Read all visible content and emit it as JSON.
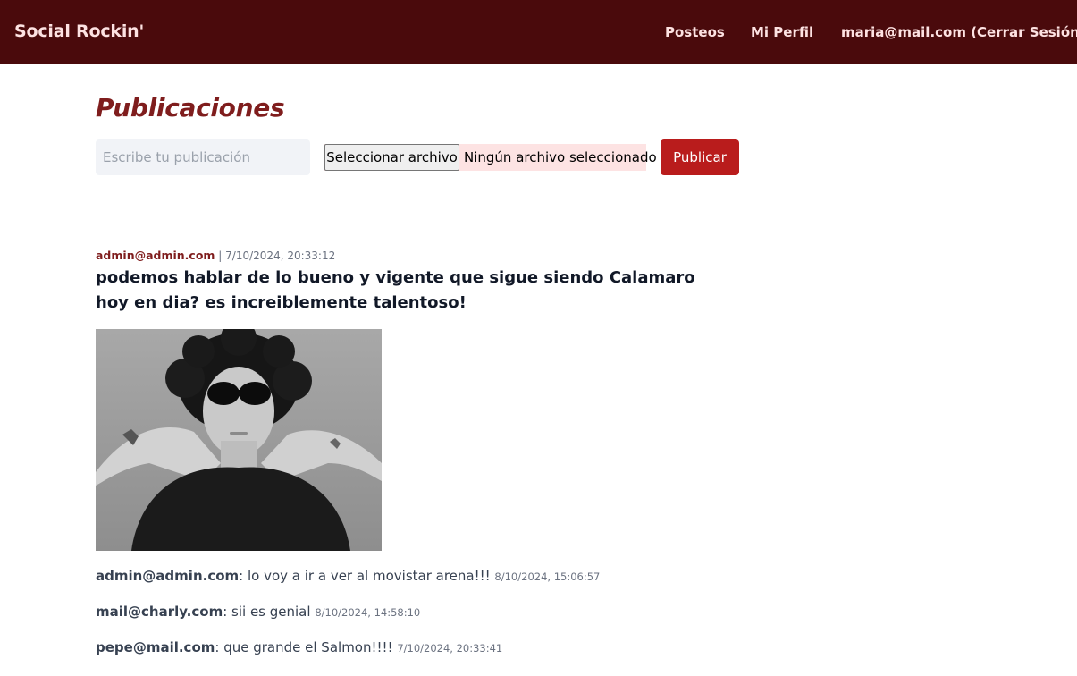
{
  "navbar": {
    "brand": "Social Rockin'",
    "links": [
      {
        "label": "Posteos"
      },
      {
        "label": "Mi Perfil"
      },
      {
        "label": "maria@mail.com (Cerrar Sesión)"
      }
    ]
  },
  "page": {
    "title": "Publicaciones"
  },
  "composer": {
    "placeholder": "Escribe tu publicación",
    "file_button_label": "Seleccionar archivo",
    "file_status": "Ningún archivo seleccionado",
    "publish_label": "Publicar"
  },
  "posts": [
    {
      "author": "admin@admin.com",
      "separator": "|",
      "timestamp": "7/10/2024, 20:33:12",
      "text": "podemos hablar de lo bueno y vigente que sigue siendo Calamaro hoy en dia? es increiblemente talentoso!",
      "comments": [
        {
          "author": "admin@admin.com",
          "text": ": lo voy a ir a ver al movistar arena!!!",
          "timestamp": "8/10/2024, 15:06:57"
        },
        {
          "author": "mail@charly.com",
          "text": ": sii es genial",
          "timestamp": "8/10/2024, 14:58:10"
        },
        {
          "author": "pepe@mail.com",
          "text": ": que grande el Salmon!!!!",
          "timestamp": "7/10/2024, 20:33:41"
        }
      ]
    }
  ],
  "colors": {
    "navbar_bg": "#4a0a0c",
    "nav_text": "#fde2e2",
    "accent": "#7f1d1d",
    "publish_button": "#b91c1c",
    "input_bg": "#f1f3f7",
    "file_picker_bg": "#fde3e3"
  }
}
